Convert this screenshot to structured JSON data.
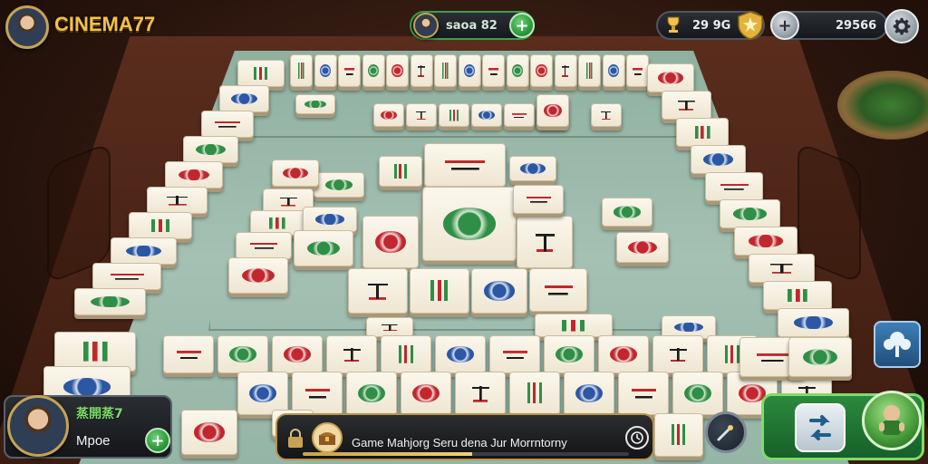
{
  "game": {
    "brand_title": "CINEMA77"
  },
  "hud": {
    "center_score": "saoa 82",
    "trophy_value": "29 9G",
    "coins_value": "29566"
  },
  "player": {
    "name": "蒸開蒸7",
    "subtitle": "Mpoe"
  },
  "message": {
    "text": "Game Mahjorg  Seru dena  Jur Morrntorny"
  },
  "icons": {
    "brand_avatar": "player-portrait-icon",
    "center_avatar": "player-portrait-icon",
    "center_add": "plus-icon",
    "trophy": "trophy-icon",
    "shield": "gold-shield-icon",
    "coins_add": "plus-icon",
    "settings": "gear-icon",
    "player_avatar": "player-portrait-icon",
    "player_add": "plus-icon",
    "message_lock": "lock-icon",
    "message_chest": "treasure-chest-icon",
    "message_timer": "clock-icon",
    "hint": "magic-wand-icon",
    "shuffle": "shuffle-icon",
    "mascot": "green-mascot-icon",
    "side_tool": "tree-icon"
  },
  "colors": {
    "brand_gold": "#f2c14a",
    "accent_green": "#3aa04a",
    "felt": "#a4c1b3",
    "wood": "#3c1c10"
  }
}
